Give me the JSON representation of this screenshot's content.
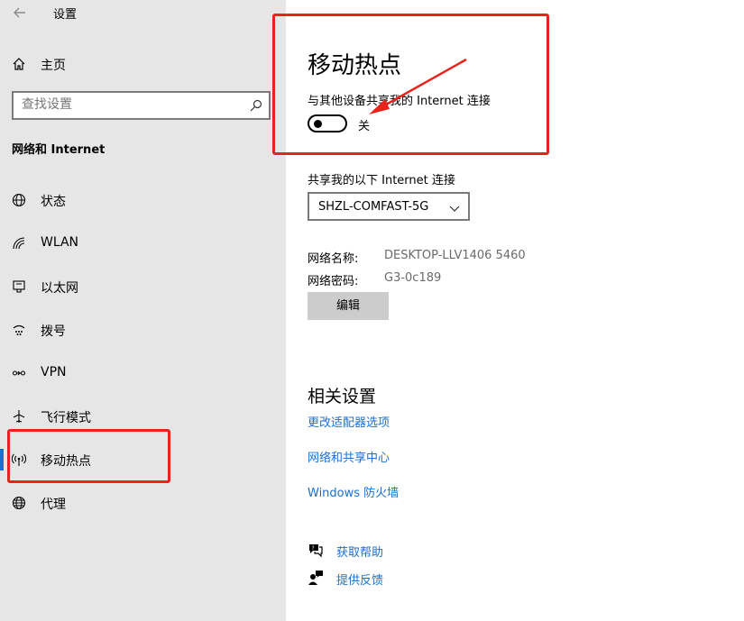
{
  "window": {
    "title": "设置"
  },
  "sidebar": {
    "home_label": "主页",
    "search": {
      "placeholder": "查找设置"
    },
    "section_title": "网络和 Internet",
    "items": [
      {
        "label": "状态",
        "icon": "globe-status-icon"
      },
      {
        "label": "WLAN",
        "icon": "wifi-icon"
      },
      {
        "label": "以太网",
        "icon": "ethernet-icon"
      },
      {
        "label": "拨号",
        "icon": "dialup-icon"
      },
      {
        "label": "VPN",
        "icon": "vpn-icon"
      },
      {
        "label": "飞行模式",
        "icon": "airplane-icon"
      },
      {
        "label": "移动热点",
        "icon": "hotspot-icon",
        "active": true
      },
      {
        "label": "代理",
        "icon": "globe-icon"
      }
    ]
  },
  "main": {
    "title": "移动热点",
    "share_desc": "与其他设备共享我的 Internet 连接",
    "toggle": {
      "state": "off",
      "label": "关"
    },
    "share_from_label": "共享我的以下 Internet 连接",
    "dropdown": {
      "selected": "SHZL-COMFAST-5G"
    },
    "network_name_label": "网络名称:",
    "network_name_value": "DESKTOP-LLV1406 5460",
    "network_password_label": "网络密码:",
    "network_password_value": "G3-0c189",
    "edit_button": "编辑",
    "related_title": "相关设置",
    "links": [
      "更改适配器选项",
      "网络和共享中心",
      "Windows 防火墙"
    ],
    "help": {
      "get_help": "获取帮助",
      "feedback": "提供反馈"
    }
  },
  "colors": {
    "accent": "#1a6fd1",
    "annotation": "#e8231b",
    "sidebar_bg": "#e6e6e6"
  }
}
